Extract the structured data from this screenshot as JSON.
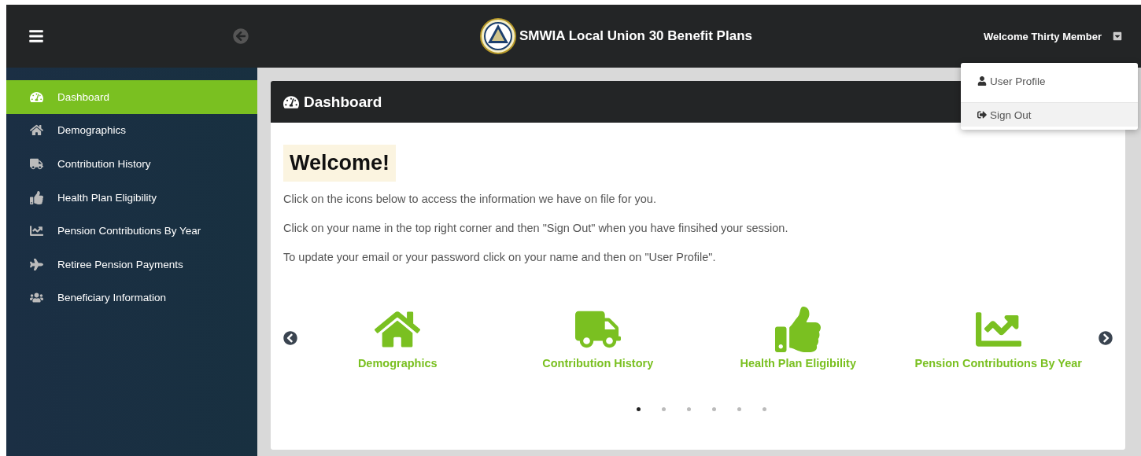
{
  "header": {
    "title": "SMWIA Local Union 30 Benefit Plans",
    "user": "Welcome Thirty Member"
  },
  "user_menu": {
    "items": [
      {
        "label": "User Profile"
      },
      {
        "label": "Sign Out",
        "selected": true
      }
    ]
  },
  "sidebar": {
    "items": [
      {
        "label": "Dashboard",
        "selected": true
      },
      {
        "label": "Demographics",
        "selected": false
      },
      {
        "label": "Contribution History",
        "selected": false
      },
      {
        "label": "Health Plan Eligibility",
        "selected": false
      },
      {
        "label": "Pension Contributions By Year",
        "selected": false
      },
      {
        "label": "Retiree Pension Payments",
        "selected": false
      },
      {
        "label": "Beneficiary Information",
        "selected": false
      }
    ]
  },
  "panel": {
    "title": "Dashboard",
    "welcome": "Welcome!",
    "paragraphs": [
      "Click on the icons below to access the information we have on file for you.",
      "Click on your name in the top right corner and then \"Sign Out\" when you have finsihed your session.",
      "To update your email or your password click on your name and then on \"User Profile\"."
    ]
  },
  "carousel": {
    "tiles": [
      {
        "label": "Demographics"
      },
      {
        "label": "Contribution History"
      },
      {
        "label": "Health Plan Eligibility"
      },
      {
        "label": "Pension Contributions By Year"
      }
    ],
    "dots": [
      {
        "selected": true
      },
      {
        "selected": false
      },
      {
        "selected": false
      },
      {
        "selected": false
      },
      {
        "selected": false
      },
      {
        "selected": false
      }
    ]
  }
}
